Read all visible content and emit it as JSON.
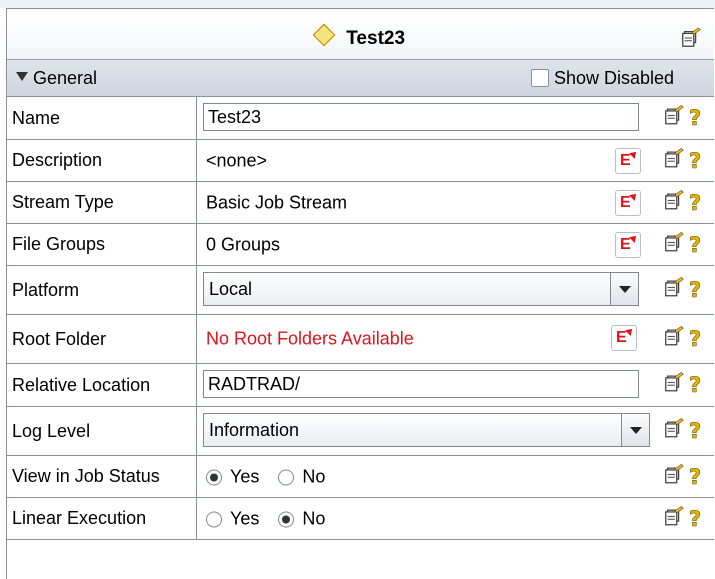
{
  "title": "Test23",
  "section": {
    "label": "General",
    "show_disabled_label": "Show Disabled"
  },
  "rows": {
    "name": {
      "label": "Name",
      "value": "Test23"
    },
    "description": {
      "label": "Description",
      "value": "<none>"
    },
    "stream_type": {
      "label": "Stream Type",
      "value": "Basic Job Stream"
    },
    "file_groups": {
      "label": "File Groups",
      "value": "0 Groups"
    },
    "platform": {
      "label": "Platform",
      "value": "Local"
    },
    "root_folder": {
      "label": "Root Folder",
      "value": "No Root Folders Available"
    },
    "relative_location": {
      "label": "Relative Location",
      "value": "RADTRAD/"
    },
    "log_level": {
      "label": "Log Level",
      "value": "Information"
    },
    "view_in_job_status": {
      "label": "View in Job Status",
      "yes": "Yes",
      "no": "No",
      "selected": "Yes"
    },
    "linear_execution": {
      "label": "Linear Execution",
      "yes": "Yes",
      "no": "No",
      "selected": "No"
    }
  },
  "help_glyph": "?",
  "expression_glyph": "E",
  "colors": {
    "error_text": "#e0141b",
    "section_bg": "#d6dce3",
    "help_icon": "#e5b800"
  },
  "icons": [
    "diamond-icon",
    "edit-icon",
    "help-icon",
    "expression-icon",
    "chevron-down-icon",
    "collapse-triangle-icon"
  ]
}
